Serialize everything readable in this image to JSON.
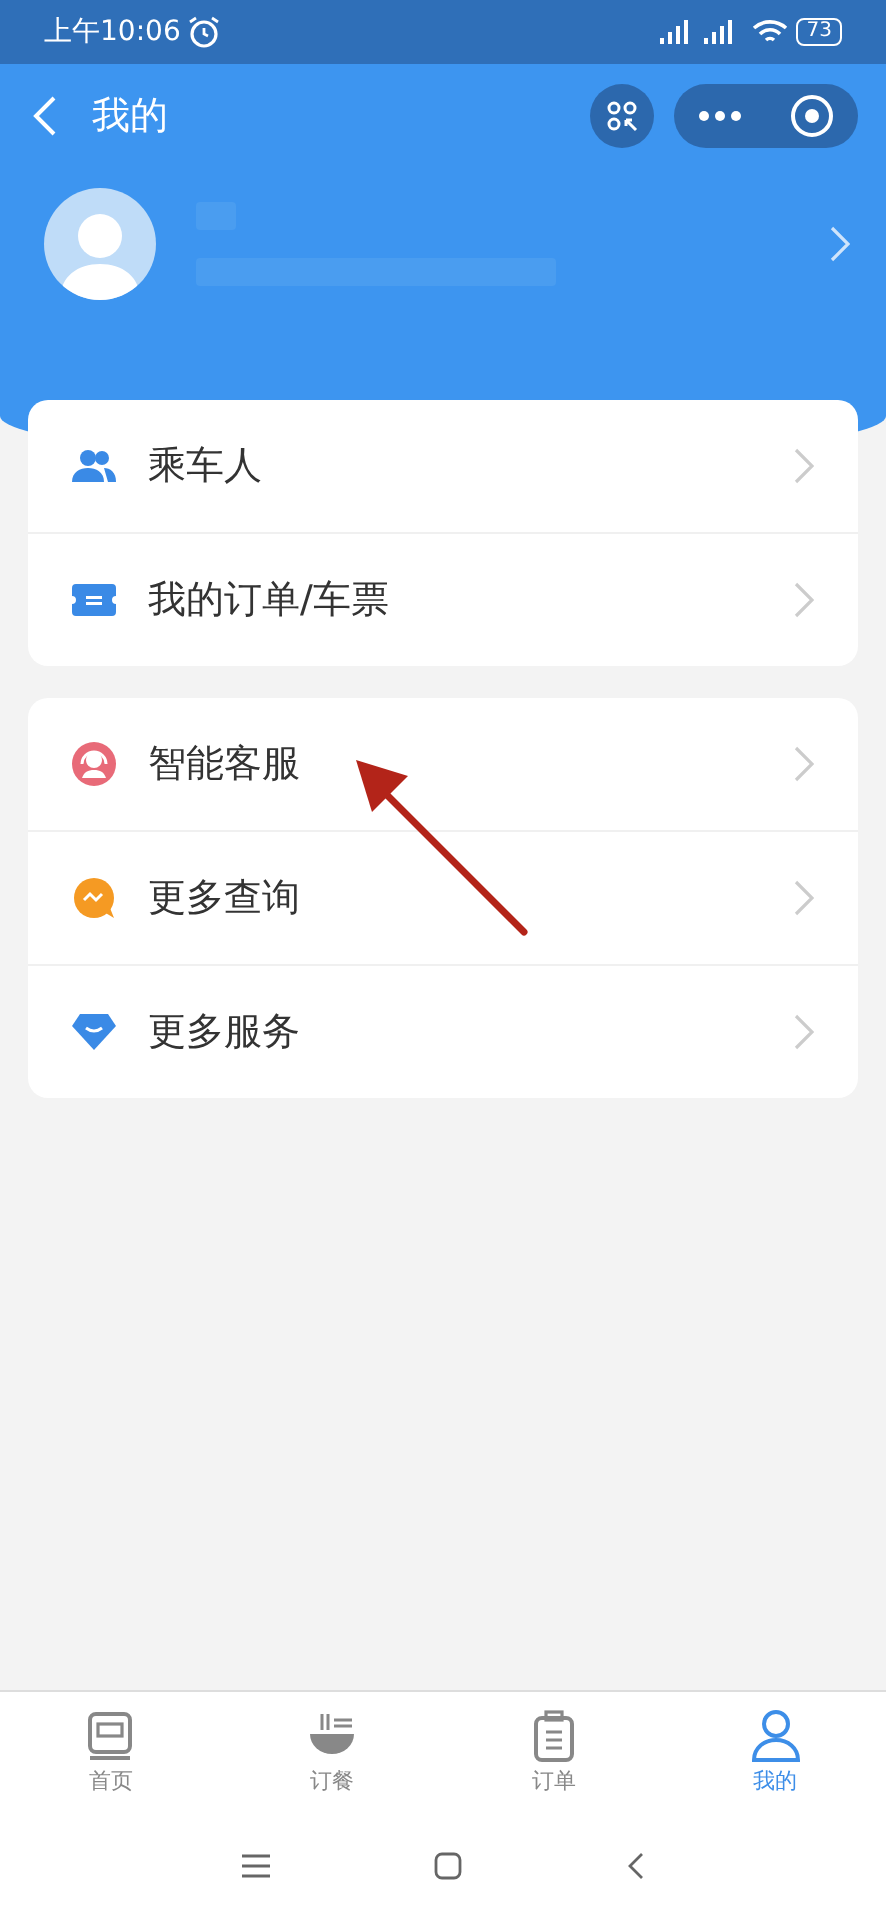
{
  "status_bar": {
    "time": "上午10:06",
    "battery": "73"
  },
  "header": {
    "title": "我的"
  },
  "menu_groups": [
    {
      "items": [
        {
          "label": "乘车人",
          "kind": "passengers"
        },
        {
          "label": "我的订单/车票",
          "kind": "ticket"
        }
      ]
    },
    {
      "items": [
        {
          "label": "智能客服",
          "kind": "support"
        },
        {
          "label": "更多查询",
          "kind": "query"
        },
        {
          "label": "更多服务",
          "kind": "diamond"
        }
      ]
    }
  ],
  "tab_bar": [
    {
      "label": "首页",
      "kind": "train",
      "selected": false
    },
    {
      "label": "订餐",
      "kind": "bowl",
      "selected": false
    },
    {
      "label": "订单",
      "kind": "clipboard",
      "selected": false
    },
    {
      "label": "我的",
      "kind": "person",
      "selected": true
    }
  ]
}
